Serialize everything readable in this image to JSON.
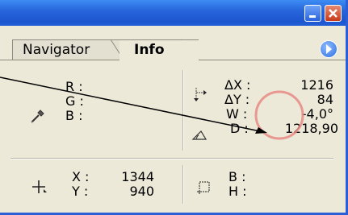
{
  "tabs": [
    {
      "label": "Navigator",
      "active": false
    },
    {
      "label": "Info",
      "active": true
    }
  ],
  "color_readout": {
    "r_label": "R :",
    "g_label": "G :",
    "b_label": "B :"
  },
  "measure_readout": {
    "dx_label": "ΔX :",
    "dx_value": "1216",
    "dy_label": "ΔY :",
    "dy_value": "84",
    "w_label": "W :",
    "w_value": "-4,0°",
    "d_label": "D :",
    "d_value": "1218,90"
  },
  "position_readout": {
    "x_label": "X :",
    "x_value": "1344",
    "y_label": "Y :",
    "y_value": "940"
  },
  "size_readout": {
    "b_label": "B :",
    "h_label": "H :"
  },
  "icons": [
    "eyedropper-icon",
    "crosshair-icon",
    "angle-arrow-icon",
    "angle-icon",
    "selection-size-icon",
    "panel-options-icon"
  ],
  "colors": {
    "title_bar": "#2866dc",
    "highlight_circle": "#e88a84",
    "panel_bg": "#ece9d8"
  }
}
